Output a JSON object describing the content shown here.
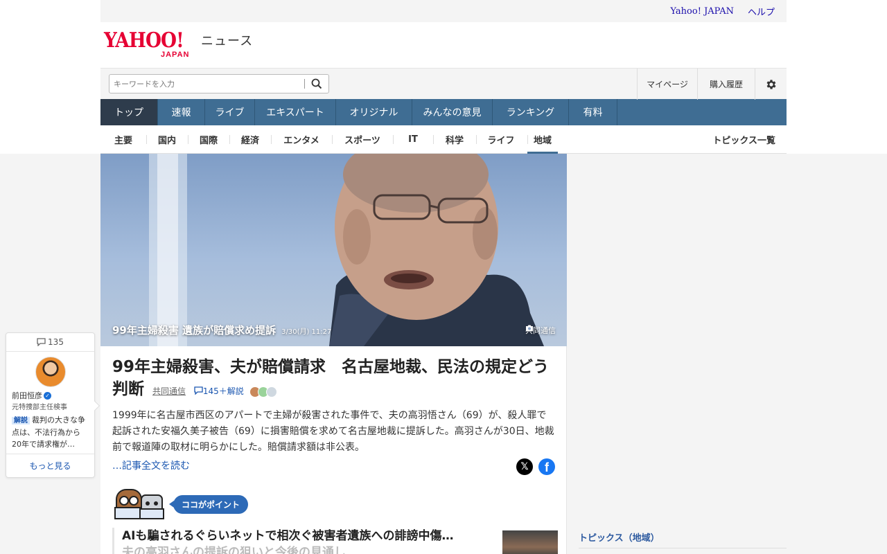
{
  "util": {
    "yahoo_japan": "Yahoo! JAPAN",
    "help": "ヘルプ"
  },
  "logo": {
    "yahoo": "YAHOO!",
    "japan": "JAPAN",
    "service": "ニュース"
  },
  "search": {
    "placeholder": "キーワードを入力"
  },
  "header_links": {
    "mypage": "マイページ",
    "history": "購入履歴",
    "settings_icon": "gear-icon"
  },
  "main_nav": [
    {
      "label": "トップ",
      "active": true
    },
    {
      "label": "速報"
    },
    {
      "label": "ライブ"
    },
    {
      "label": "エキスパート"
    },
    {
      "label": "オリジナル"
    },
    {
      "label": "みんなの意見"
    },
    {
      "label": "ランキング"
    },
    {
      "label": "有料"
    }
  ],
  "sub_nav": [
    {
      "label": "主要"
    },
    {
      "label": "国内"
    },
    {
      "label": "国際"
    },
    {
      "label": "経済"
    },
    {
      "label": "エンタメ"
    },
    {
      "label": "スポーツ"
    },
    {
      "label": "IT"
    },
    {
      "label": "科学"
    },
    {
      "label": "ライフ"
    },
    {
      "label": "地域",
      "active": true
    }
  ],
  "topics_list": "トピックス一覧",
  "hero": {
    "title": "99年主婦殺害 遺族が賠償求め提訴",
    "date": "3/30(月) 11:27",
    "credit": "共同通信"
  },
  "article": {
    "headline": "99年主婦殺害、夫が賠償請求　名古屋地裁、民法の規定どう判断",
    "source": "共同通信",
    "comments": "145＋解説",
    "summary": "1999年に名古屋市西区のアパートで主婦が殺害された事件で、夫の高羽悟さん（69）が、殺人罪で起訴された安福久美子被告（69）に損害賠償を求めて名古屋地裁に提訴した。高羽さんが30日、地裁前で報道陣の取材に明らかにした。賠償請求額は非公表。",
    "read_more": "…記事全文を読む",
    "point_label": "ココがポイント",
    "related_title": "AIも騙されるぐらいネットで相次ぐ被害者遺族への誹謗中傷…",
    "related_sub": "夫の高羽さんの提訴の狙いと今後の見通し"
  },
  "right_column": {
    "topics_header": "トピックス（地域）"
  },
  "comment_card": {
    "count": "135",
    "name": "前田恒彦",
    "title": "元特捜部主任検事",
    "tag": "解説",
    "text": "裁判の大きな争点は、不法行為から20年で請求権が…",
    "more": "もっと見る"
  },
  "colors": {
    "nav_bg": "#3f6d93",
    "nav_active": "#2e3c4c",
    "brand_red": "#e60033",
    "link_blue": "#1a56b0"
  }
}
